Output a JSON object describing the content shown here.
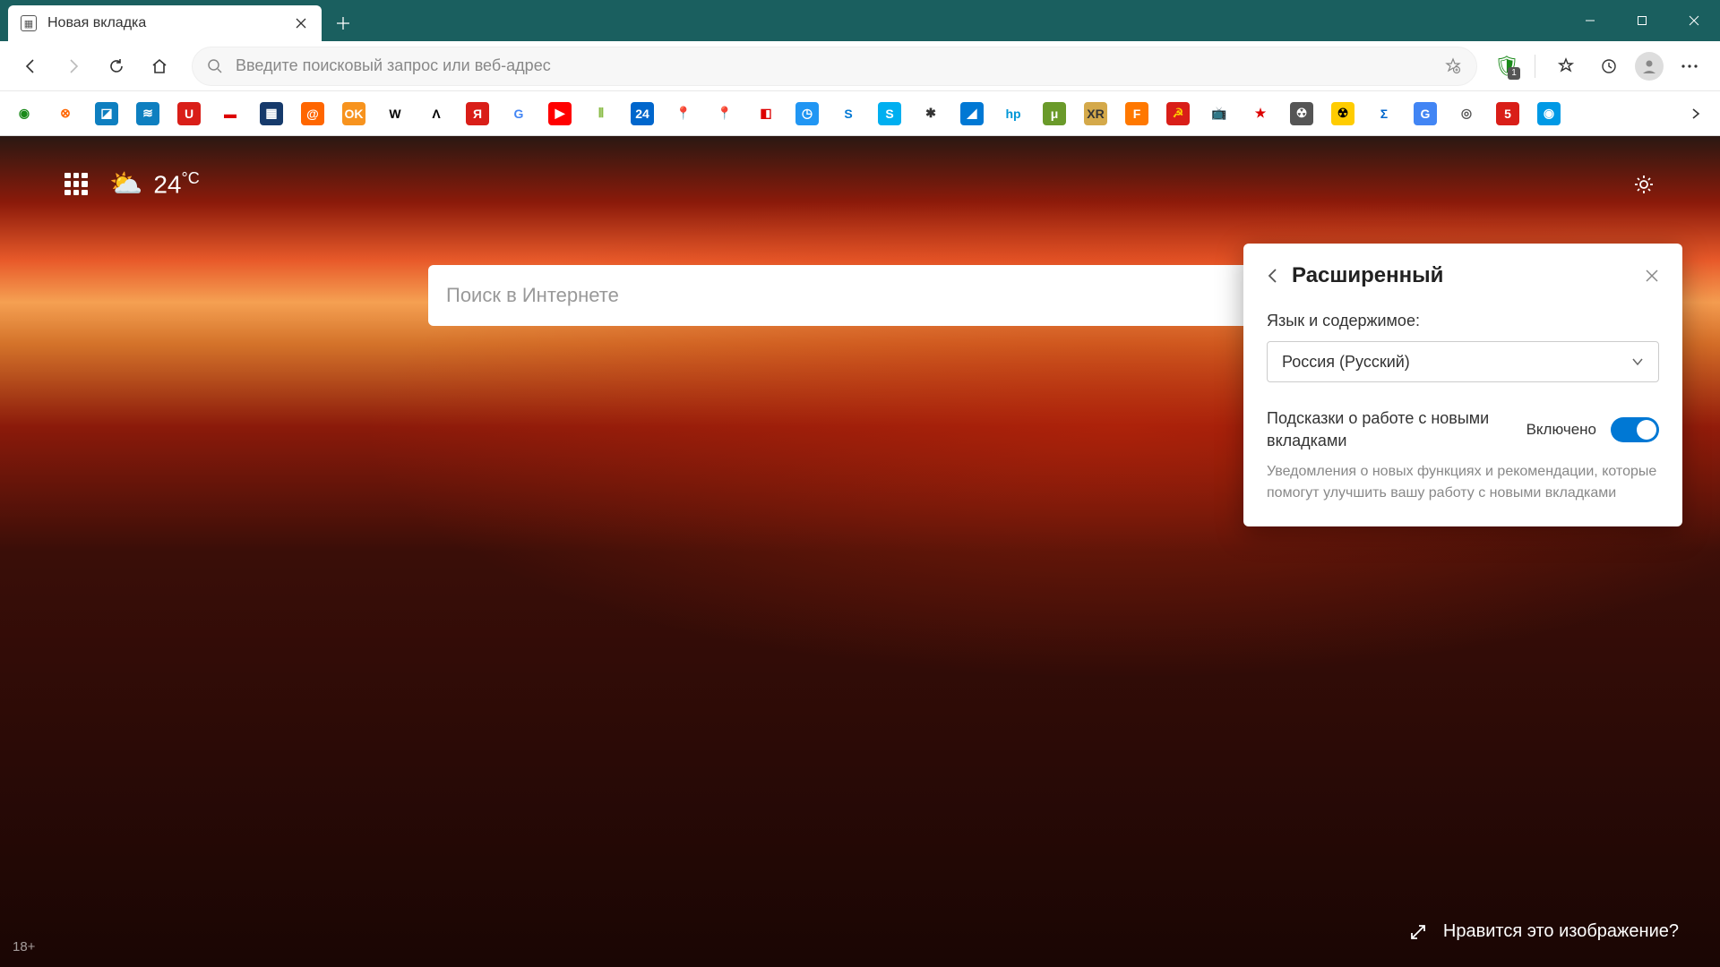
{
  "tab": {
    "title": "Новая вкладка"
  },
  "addressbar": {
    "placeholder": "Введите поисковый запрос или веб-адрес"
  },
  "extension_badge": "1",
  "bookmarks": [
    {
      "bg": "#fff",
      "fg": "#1a8a1a",
      "txt": "◉",
      "name": "sberbank"
    },
    {
      "bg": "#fff",
      "fg": "#f60",
      "txt": "⊗",
      "name": "bookmark-2"
    },
    {
      "bg": "#0e7fc0",
      "fg": "#fff",
      "txt": "◪",
      "name": "bookmark-3"
    },
    {
      "bg": "#0e7fc0",
      "fg": "#fff",
      "txt": "≋",
      "name": "bookmark-4"
    },
    {
      "bg": "#d91e18",
      "fg": "#fff",
      "txt": "U",
      "name": "bookmark-5"
    },
    {
      "bg": "#fff",
      "fg": "#d00",
      "txt": "▬",
      "name": "bookmark-6"
    },
    {
      "bg": "#163a6b",
      "fg": "#fff",
      "txt": "▦",
      "name": "bookmark-7"
    },
    {
      "bg": "#f60",
      "fg": "#fff",
      "txt": "@",
      "name": "mail-ru"
    },
    {
      "bg": "#f7931e",
      "fg": "#fff",
      "txt": "OK",
      "name": "odnoklassniki"
    },
    {
      "bg": "#fff",
      "fg": "#000",
      "txt": "W",
      "name": "wikipedia"
    },
    {
      "bg": "#fff",
      "fg": "#000",
      "txt": "Λ",
      "name": "bookmark-11"
    },
    {
      "bg": "#d91e18",
      "fg": "#fff",
      "txt": "Я",
      "name": "yandex"
    },
    {
      "bg": "#fff",
      "fg": "#4285f4",
      "txt": "G",
      "name": "google"
    },
    {
      "bg": "#f00",
      "fg": "#fff",
      "txt": "▶",
      "name": "youtube"
    },
    {
      "bg": "#fff",
      "fg": "#8b4",
      "txt": "⦀",
      "name": "bookmark-15"
    },
    {
      "bg": "#0066cc",
      "fg": "#fff",
      "txt": "24",
      "name": "bookmark-16"
    },
    {
      "bg": "#fff",
      "fg": "#4285f4",
      "txt": "📍",
      "name": "google-maps"
    },
    {
      "bg": "#fff",
      "fg": "#d00",
      "txt": "📍",
      "name": "yandex-maps"
    },
    {
      "bg": "#fff",
      "fg": "#d00",
      "txt": "◧",
      "name": "bookmark-19"
    },
    {
      "bg": "#2196f3",
      "fg": "#fff",
      "txt": "◷",
      "name": "bookmark-20"
    },
    {
      "bg": "#fff",
      "fg": "#0078d4",
      "txt": "S",
      "name": "bookmark-21"
    },
    {
      "bg": "#00aff0",
      "fg": "#fff",
      "txt": "S",
      "name": "skype"
    },
    {
      "bg": "#fff",
      "fg": "#333",
      "txt": "✱",
      "name": "bookmark-23"
    },
    {
      "bg": "#0078d4",
      "fg": "#fff",
      "txt": "◢",
      "name": "bookmark-24"
    },
    {
      "bg": "#fff",
      "fg": "#0096d6",
      "txt": "hp",
      "name": "hp"
    },
    {
      "bg": "#6a9a2a",
      "fg": "#fff",
      "txt": "μ",
      "name": "utorrent"
    },
    {
      "bg": "#d4a94a",
      "fg": "#333",
      "txt": "XR",
      "name": "bookmark-27"
    },
    {
      "bg": "#ff7800",
      "fg": "#fff",
      "txt": "F",
      "name": "bookmark-28"
    },
    {
      "bg": "#d91e18",
      "fg": "#fc0",
      "txt": "☭",
      "name": "bookmark-29"
    },
    {
      "bg": "#fff",
      "fg": "#8b4513",
      "txt": "📺",
      "name": "bookmark-30"
    },
    {
      "bg": "#fff",
      "fg": "#d00",
      "txt": "★",
      "name": "bookmark-31"
    },
    {
      "bg": "#555",
      "fg": "#fff",
      "txt": "☢",
      "name": "bookmark-32"
    },
    {
      "bg": "#fc0",
      "fg": "#000",
      "txt": "☢",
      "name": "bookmark-33"
    },
    {
      "bg": "#fff",
      "fg": "#0066cc",
      "txt": "Σ",
      "name": "bookmark-34"
    },
    {
      "bg": "#4285f4",
      "fg": "#fff",
      "txt": "G",
      "name": "google-translate"
    },
    {
      "bg": "#fff",
      "fg": "#555",
      "txt": "◎",
      "name": "bookmark-36"
    },
    {
      "bg": "#d91e18",
      "fg": "#fff",
      "txt": "5",
      "name": "bookmark-37"
    },
    {
      "bg": "#0099e5",
      "fg": "#fff",
      "txt": "◉",
      "name": "bookmark-38"
    }
  ],
  "ntp": {
    "weather_temp": "24",
    "weather_unit": "°C",
    "search_placeholder": "Поиск в Интернете",
    "age_rating": "18+",
    "image_like": "Нравится это изображение?"
  },
  "panel": {
    "title": "Расширенный",
    "lang_label": "Язык и содержимое:",
    "lang_value": "Россия (Русский)",
    "tips_label": "Подсказки о работе с новыми вкладками",
    "tips_state": "Включено",
    "tips_desc": "Уведомления о новых функциях и рекомендации, которые помогут улучшить вашу работу с новыми вкладками"
  }
}
